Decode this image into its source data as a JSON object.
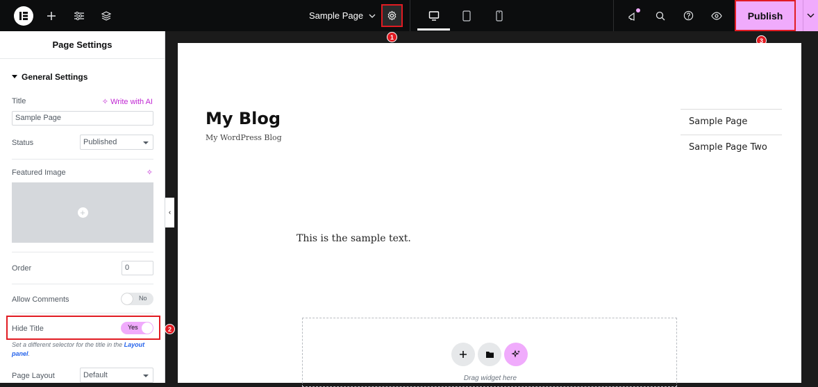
{
  "topbar": {
    "page_name": "Sample Page",
    "publish_label": "Publish",
    "badges": [
      "1",
      "2",
      "3"
    ]
  },
  "panel": {
    "header": "Page Settings",
    "section": "General Settings",
    "title_label": "Title",
    "write_ai": "Write with AI",
    "title_value": "Sample Page",
    "status_label": "Status",
    "status_value": "Published",
    "featured_label": "Featured Image",
    "order_label": "Order",
    "order_value": "0",
    "comments_label": "Allow Comments",
    "comments_toggle": "No",
    "hide_title_label": "Hide Title",
    "hide_title_toggle": "Yes",
    "help_prefix": "Set a different selector for the title in the ",
    "help_link": "Layout panel",
    "help_suffix": ".",
    "layout_label": "Page Layout",
    "layout_value": "Default"
  },
  "canvas": {
    "site_title": "My Blog",
    "tagline": "My WordPress Blog",
    "nav": [
      "Sample Page",
      "Sample Page Two"
    ],
    "body_text": "This is the sample text.",
    "drop_label": "Drag widget here"
  },
  "colors": {
    "accent": "#f0abfc",
    "highlight": "#e11b22",
    "topbar": "#0c0d0e"
  }
}
